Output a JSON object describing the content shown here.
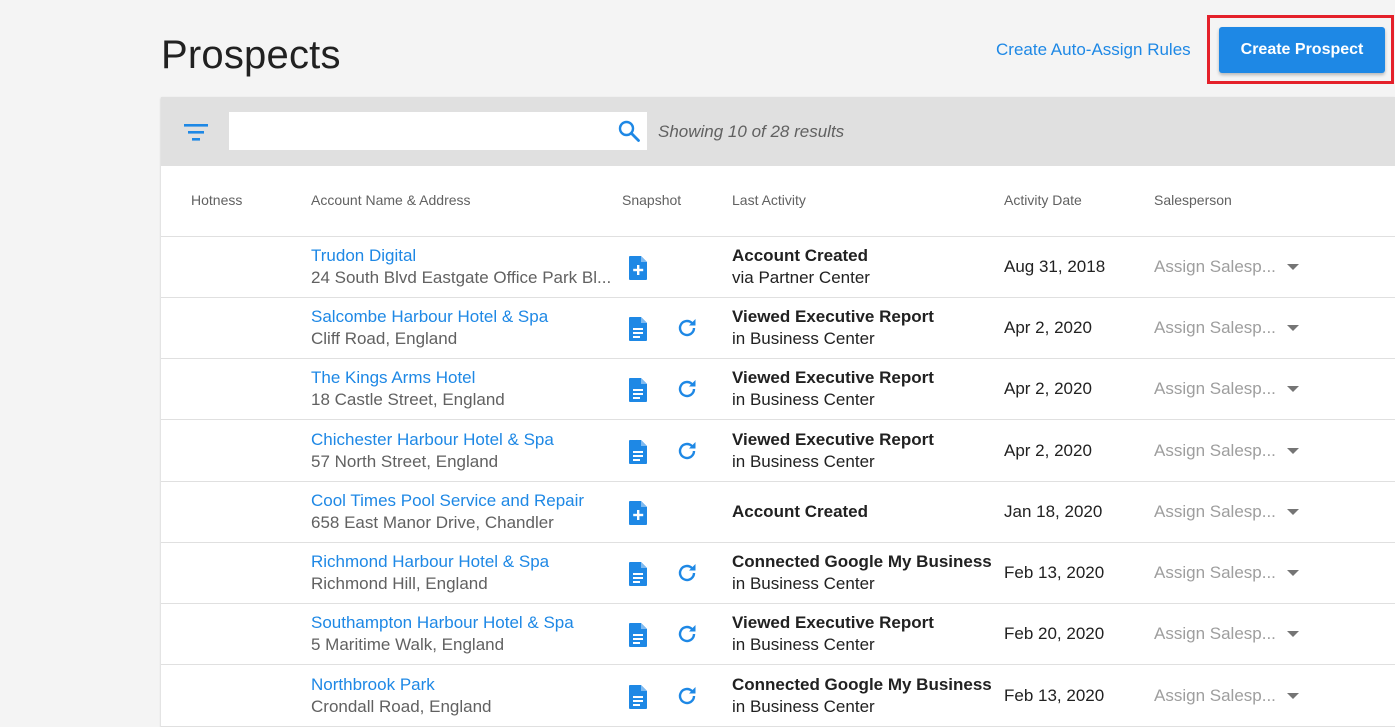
{
  "page": {
    "title": "Prospects",
    "auto_assign_label": "Create Auto-Assign Rules",
    "create_label": "Create Prospect"
  },
  "toolbar": {
    "search_value": "",
    "results_text": "Showing 10 of 28 results"
  },
  "table": {
    "columns": [
      "Hotness",
      "Account Name & Address",
      "Snapshot",
      "Last Activity",
      "Activity Date",
      "Salesperson"
    ],
    "rows": [
      {
        "name": "Trudon Digital",
        "address": "24 South Blvd Eastgate Office Park Bl...",
        "snapshot": "create",
        "refresh": false,
        "activity": "Account Created",
        "activity_sub": "via Partner Center",
        "date": "Aug 31, 2018",
        "salesperson": "Assign Salesp..."
      },
      {
        "name": "Salcombe Harbour Hotel & Spa",
        "address": "Cliff Road, England",
        "snapshot": "view",
        "refresh": true,
        "activity": "Viewed Executive Report",
        "activity_sub": "in Business Center",
        "date": "Apr 2, 2020",
        "salesperson": "Assign Salesp..."
      },
      {
        "name": "The Kings Arms Hotel",
        "address": "18 Castle Street, England",
        "snapshot": "view",
        "refresh": true,
        "activity": "Viewed Executive Report",
        "activity_sub": "in Business Center",
        "date": "Apr 2, 2020",
        "salesperson": "Assign Salesp..."
      },
      {
        "name": "Chichester Harbour Hotel & Spa",
        "address": "57 North Street, England",
        "snapshot": "view",
        "refresh": true,
        "activity": "Viewed Executive Report",
        "activity_sub": "in Business Center",
        "date": "Apr 2, 2020",
        "salesperson": "Assign Salesp..."
      },
      {
        "name": "Cool Times Pool Service and Repair",
        "address": "658 East Manor Drive, Chandler",
        "snapshot": "create",
        "refresh": false,
        "activity": "Account Created",
        "activity_sub": "",
        "date": "Jan 18, 2020",
        "salesperson": "Assign Salesp..."
      },
      {
        "name": "Richmond Harbour Hotel & Spa",
        "address": "Richmond Hill, England",
        "snapshot": "view",
        "refresh": true,
        "activity": "Connected Google My Business",
        "activity_sub": "in Business Center",
        "date": "Feb 13, 2020",
        "salesperson": "Assign Salesp..."
      },
      {
        "name": "Southampton Harbour Hotel & Spa",
        "address": "5 Maritime Walk, England",
        "snapshot": "view",
        "refresh": true,
        "activity": "Viewed Executive Report",
        "activity_sub": "in Business Center",
        "date": "Feb 20, 2020",
        "salesperson": "Assign Salesp..."
      },
      {
        "name": "Northbrook Park",
        "address": "Crondall Road, England",
        "snapshot": "view",
        "refresh": true,
        "activity": "Connected Google My Business",
        "activity_sub": "in Business Center",
        "date": "Feb 13, 2020",
        "salesperson": "Assign Salesp..."
      }
    ]
  },
  "colors": {
    "accent": "#1e88e5",
    "highlight": "#e4202a",
    "toolbar": "#e0e0e0"
  },
  "icons": {
    "filter": "filter-icon",
    "search": "search-icon",
    "snapshot_create": "document-plus-icon",
    "snapshot_view": "document-icon",
    "refresh": "refresh-icon",
    "dropdown": "caret-down-icon"
  }
}
